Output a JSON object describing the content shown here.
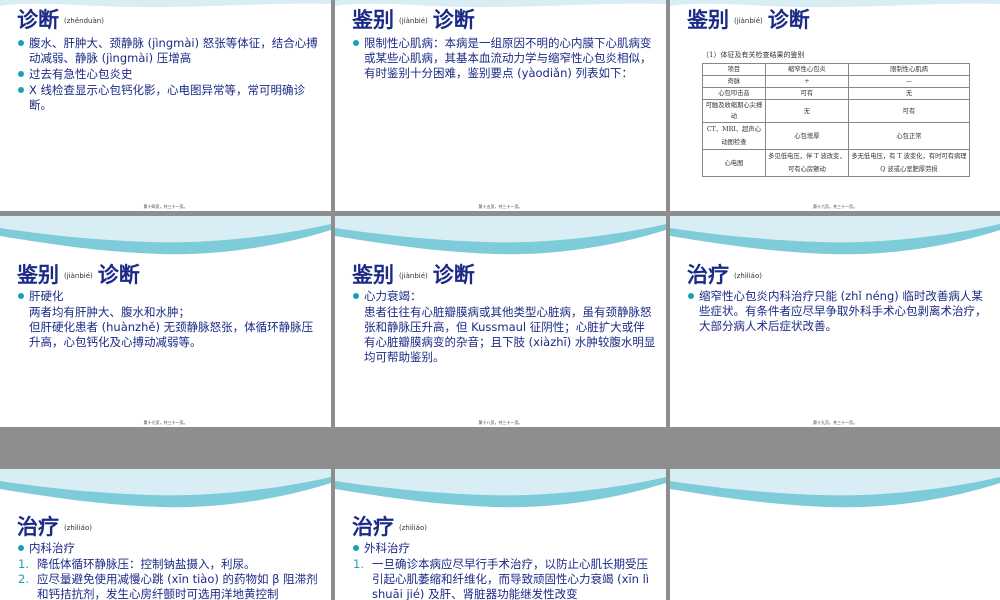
{
  "slides": [
    {
      "title": "诊断",
      "title_py": "(zhěnduàn)",
      "lines": [
        {
          "type": "bullet",
          "text": "腹水、肝肿大、颈静脉 (jìngmài) 怒张等体征，结合心搏动减弱、静脉 (jìngmài) 压增高"
        },
        {
          "type": "bullet",
          "text": "过去有急性心包炎史"
        },
        {
          "type": "bullet",
          "text": "X 线检查显示心包钙化影，心电图异常等，常可明确诊断。"
        }
      ],
      "footer": "第十四页，共三十一页。"
    },
    {
      "title_a": "鉴别",
      "title_py": "(jiànbié)",
      "title_b": "诊断",
      "lines": [
        {
          "type": "bullet",
          "text": "限制性心肌病：本病是一组原因不明的心内膜下心肌病变或某些心肌病，其基本血流动力学与缩窄性心包炎相似，有时鉴别十分困难，鉴别要点 (yàodiǎn) 列表如下："
        }
      ],
      "footer": "第十五页，共三十一页。"
    },
    {
      "title_a": "鉴别",
      "title_py": "(jiànbié)",
      "title_b": "诊断",
      "table_caption": "（1）体征及有关检查结果的鉴别",
      "table": {
        "header": [
          "项目",
          "缩窄性心包炎",
          "限制性心肌病"
        ],
        "rows": [
          [
            "奇脉",
            "+",
            "—"
          ],
          [
            "心包叩击音",
            "可有",
            "无"
          ],
          [
            "可触及收缩期心尖搏动",
            "无",
            "可有"
          ],
          [
            "CT、MRI、超声心动图检查",
            "心包增厚",
            "心包正常"
          ],
          [
            "心电图",
            "多见低电压，伴 T 波改变，可有心房颤动",
            "多无低电压，有 T 波变化，有时可有病理 Q 波或心室肥厚劳损"
          ]
        ]
      },
      "footer": "第十六页，共三十一页。"
    },
    {
      "title_a": "鉴别",
      "title_py": "(jiànbié)",
      "title_b": "诊断",
      "lines": [
        {
          "type": "bullet",
          "text": "肝硬化"
        },
        {
          "type": "plain",
          "text": "两者均有肝肿大、腹水和水肿；"
        },
        {
          "type": "plain",
          "text": "但肝硬化患者 (huànzhě) 无颈静脉怒张，体循环静脉压升高，心包钙化及心搏动减弱等。"
        }
      ],
      "footer": "第十七页，共三十一页。"
    },
    {
      "title_a": "鉴别",
      "title_py": "(jiànbié)",
      "title_b": "诊断",
      "lines": [
        {
          "type": "bullet",
          "text": "心力衰竭："
        },
        {
          "type": "plain",
          "text": "患者往往有心脏瓣膜病或其他类型心脏病，虽有颈静脉怒张和静脉压升高，但 Kussmaul 征阴性；心脏扩大或伴有心脏瓣膜病变的杂音；且下肢 (xiàzhī) 水肿较腹水明显均可帮助鉴别。"
        }
      ],
      "footer": "第十八页，共三十一页。"
    },
    {
      "title": "治疗",
      "title_py": "(zhìliáo)",
      "lines": [
        {
          "type": "bullet",
          "text": "缩窄性心包炎内科治疗只能 (zhǐ néng) 临时改善病人某些症状。有条件者应尽早争取外科手术心包剥离术治疗，大部分病人术后症状改善。"
        }
      ],
      "footer": "第十九页，共三十一页。"
    },
    {
      "title": "治疗",
      "title_py": "(zhìliáo)",
      "lines": [
        {
          "type": "bullet",
          "text": "内科治疗"
        },
        {
          "type": "num",
          "n": "1.",
          "text": "降低体循环静脉压：控制钠盐摄入，利尿。"
        },
        {
          "type": "num",
          "n": "2.",
          "text": "应尽量避免使用减慢心跳 (xīn tiào) 的药物如 β 阻滞剂和钙拮抗剂，发生心房纤颤时可选用洋地黄控制"
        }
      ],
      "footer": ""
    },
    {
      "title": "治疗",
      "title_py": "(zhìliáo)",
      "lines": [
        {
          "type": "bullet",
          "text": "外科治疗"
        },
        {
          "type": "num",
          "n": "1.",
          "text": "一旦确诊本病应尽早行手术治疗，以防止心肌长期受压引起心肌萎缩和纤维化，而导致顽固性心力衰竭 (xīn lì shuāi jié) 及肝、肾脏器功能继发性改变"
        }
      ],
      "footer": ""
    },
    {
      "title": "",
      "lines": [],
      "footer": ""
    }
  ]
}
